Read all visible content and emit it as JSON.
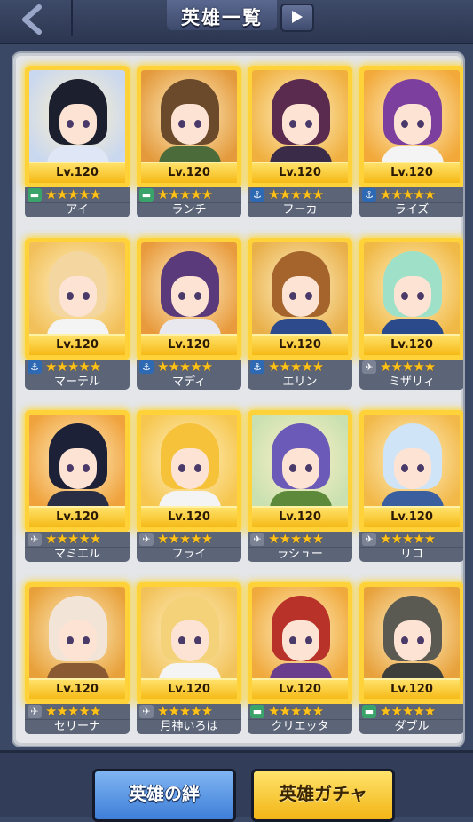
{
  "header": {
    "title": "英雄一覧"
  },
  "heroes": [
    {
      "name": "アイ",
      "level": "Lv.120",
      "type": "tank-icon",
      "stars": "★★★★★",
      "hair": "#1b1f2e",
      "bg": "#c9d7ef",
      "body": "#dfe6f5"
    },
    {
      "name": "ランチ",
      "level": "Lv.120",
      "type": "tank-icon",
      "stars": "★★★★★",
      "hair": "#6b4a2b",
      "bg": "#e49a3c",
      "body": "#4c6b3a"
    },
    {
      "name": "フーカ",
      "level": "Lv.120",
      "type": "anchor-icon",
      "stars": "★★★★★",
      "hair": "#5a2a4f",
      "bg": "#f0b040",
      "body": "#3a2c48"
    },
    {
      "name": "ライズ",
      "level": "Lv.120",
      "type": "anchor-icon",
      "stars": "★★★★★",
      "hair": "#7c3f9e",
      "bg": "#f2a93a",
      "body": "#f4f4f4"
    },
    {
      "name": "マーテル",
      "level": "Lv.120",
      "type": "anchor-icon",
      "stars": "★★★★★",
      "hair": "#f3d6a0",
      "bg": "#f2c05a",
      "body": "#f4f4f4"
    },
    {
      "name": "マディ",
      "level": "Lv.120",
      "type": "anchor-icon",
      "stars": "★★★★★",
      "hair": "#5a3a7a",
      "bg": "#e89a3c",
      "body": "#e8e8ee"
    },
    {
      "name": "エリン",
      "level": "Lv.120",
      "type": "anchor-icon",
      "stars": "★★★★★",
      "hair": "#a4642c",
      "bg": "#e9b04a",
      "body": "#2d4a8c"
    },
    {
      "name": "ミザリィ",
      "level": "Lv.120",
      "type": "jet-icon",
      "stars": "★★★★★",
      "hair": "#9fe0c8",
      "bg": "#f0b844",
      "body": "#2a4a8c"
    },
    {
      "name": "マミエル",
      "level": "Lv.120",
      "type": "jet-icon",
      "stars": "★★★★★",
      "hair": "#1c2138",
      "bg": "#f0a23c",
      "body": "#2a2e44"
    },
    {
      "name": "フライ",
      "level": "Lv.120",
      "type": "jet-icon",
      "stars": "★★★★★",
      "hair": "#f5c23a",
      "bg": "#f6c64e",
      "body": "#f4f4f4"
    },
    {
      "name": "ラシュー",
      "level": "Lv.120",
      "type": "jet-icon",
      "stars": "★★★★★",
      "hair": "#6b5ab8",
      "bg": "#c9e0b0",
      "body": "#5c8a3a"
    },
    {
      "name": "リコ",
      "level": "Lv.120",
      "type": "jet-icon",
      "stars": "★★★★★",
      "hair": "#cfe4f7",
      "bg": "#f2b848",
      "body": "#3b5f9e"
    },
    {
      "name": "セリーナ",
      "level": "Lv.120",
      "type": "jet-icon",
      "stars": "★★★★★",
      "hair": "#f3e4d8",
      "bg": "#e8a13a",
      "body": "#8a5a32"
    },
    {
      "name": "月神いろは",
      "level": "Lv.120",
      "type": "jet-icon",
      "stars": "★★★★★",
      "hair": "#f3d27a",
      "bg": "#f2c25a",
      "body": "#f4f4f4"
    },
    {
      "name": "クリエッタ",
      "level": "Lv.120",
      "type": "tank-icon",
      "stars": "★★★★★",
      "hair": "#b8322a",
      "bg": "#f0a93c",
      "body": "#6a3e8c"
    },
    {
      "name": "ダブル",
      "level": "Lv.120",
      "type": "tank-icon",
      "stars": "★★★★★",
      "hair": "#5a5a52",
      "bg": "#e8a23c",
      "body": "#3e3e3a"
    }
  ],
  "buttons": {
    "bond": "英雄の絆",
    "gacha": "英雄ガチャ"
  }
}
